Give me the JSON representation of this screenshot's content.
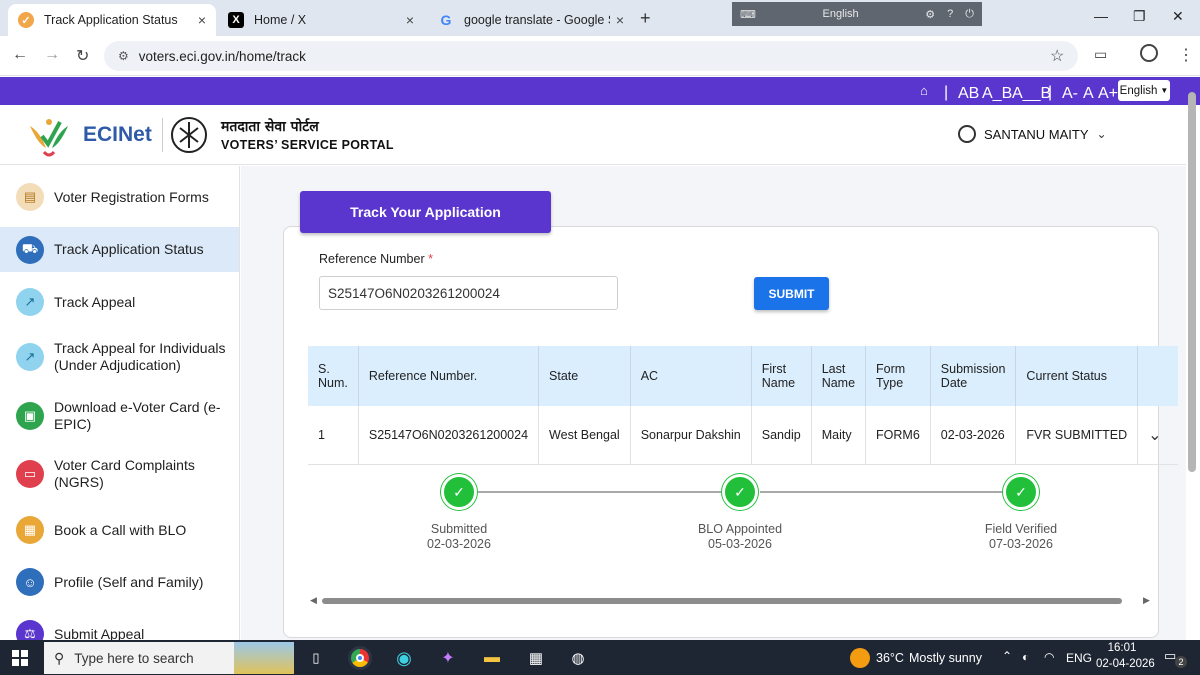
{
  "tabs": [
    {
      "title": "Track Application Status",
      "close": "×"
    },
    {
      "title": "Home / X",
      "close": "×"
    },
    {
      "title": "google translate - Google Searc",
      "close": "×"
    }
  ],
  "newtab": "+",
  "bubble": {
    "lang": "English"
  },
  "addr": {
    "url": "voters.eci.gov.in/home/track"
  },
  "topbar": {
    "a1": "AB",
    "a2": "A_B",
    "a3": "A__B",
    "sep": "|",
    "fminus": "A-",
    "fnorm": "A",
    "fplus": "A+",
    "lang": "English"
  },
  "header": {
    "brand": "ECINet",
    "hindi": "मतदाता सेवा पोर्टल",
    "portal": "VOTERS’ SERVICE PORTAL",
    "user": "SANTANU MAITY"
  },
  "sidebar": {
    "items": [
      {
        "label": "Voter Registration Forms",
        "color": "#e8a736"
      },
      {
        "label": "Track Application Status",
        "color": "#2f6ebb"
      },
      {
        "label": "Track Appeal",
        "color": "#26a3d8"
      },
      {
        "label": "Track Appeal for Individuals (Under Adjudication)",
        "color": "#26a3d8"
      },
      {
        "label": "Download e-Voter Card (e-EPIC)",
        "color": "#2fa44f"
      },
      {
        "label": "Voter Card Complaints (NGRS)",
        "color": "#e0404d"
      },
      {
        "label": "Book a Call with BLO",
        "color": "#e8a736"
      },
      {
        "label": "Profile (Self and Family)",
        "color": "#2f6ebb"
      },
      {
        "label": "Submit Appeal",
        "color": "#5a36cf"
      }
    ]
  },
  "main": {
    "title": "Track Your Application",
    "ref_label": "Reference Number",
    "required": "*",
    "ref_value": "S25147O6N0203261200024",
    "submit": "SUBMIT",
    "columns": [
      "S. Num.",
      "Reference Number.",
      "State",
      "AC",
      "First Name",
      "Last Name",
      "Form Type",
      "Submission Date",
      "Current Status"
    ],
    "row": {
      "snum": "1",
      "ref": "S25147O6N0203261200024",
      "state": "West Bengal",
      "ac": "Sonarpur Dakshin",
      "first": "Sandip",
      "last": "Maity",
      "form": "FORM6",
      "date": "02-03-2026",
      "status": "FVR SUBMITTED"
    },
    "steps": [
      {
        "label": "Submitted",
        "date": "02-03-2026"
      },
      {
        "label": "BLO Appointed",
        "date": "05-03-2026"
      },
      {
        "label": "Field Verified",
        "date": "07-03-2026"
      }
    ]
  },
  "taskbar": {
    "search": "Type here to search",
    "temp": "36°C",
    "weather": "Mostly sunny",
    "lang": "ENG",
    "time": "16:01",
    "date": "02-04-2026",
    "notif": "2"
  },
  "colors": {
    "accent": "#5a36cf",
    "submit": "#1a73e8",
    "step": "#22c03a",
    "header_bg": "#daeefe"
  }
}
